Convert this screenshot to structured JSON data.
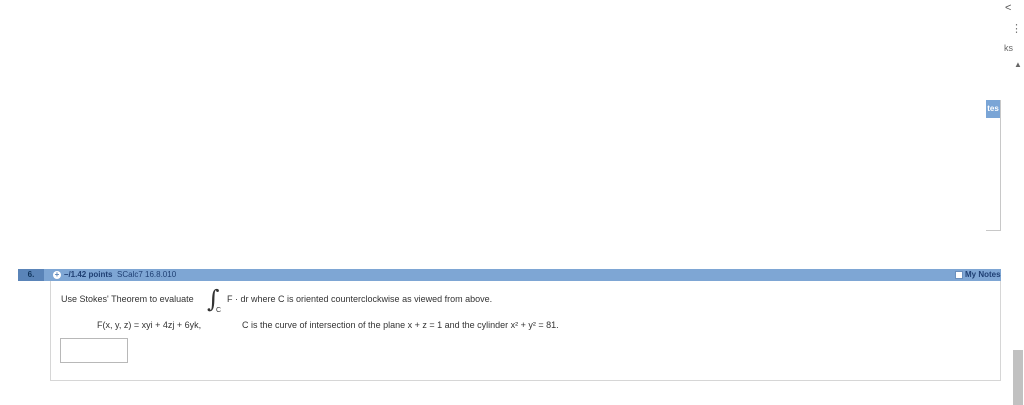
{
  "chrome": {
    "back_glyph": "<",
    "more_glyph": "⋮",
    "ks_fragment": "ks",
    "up_arrow": "▲"
  },
  "prev_notes_fragment": "tes",
  "question": {
    "number": "6.",
    "points": "–/1.42 points",
    "code": "SCalc7 16.8.010",
    "my_notes_label": "My Notes",
    "prompt_lead": "Use Stokes' Theorem to evaluate",
    "integral_symbol": "∫",
    "integral_subscript": "C",
    "prompt_tail": "F · dr  where C is oriented counterclockwise as viewed from above.",
    "field": "F(x, y, z) = xyi + 4zj + 6yk,",
    "curve": "C is the curve of intersection of the plane  x + z = 1  and the cylinder  x² + y² = 81.",
    "answer_value": ""
  },
  "colors": {
    "header_bar": "#7ea6d4",
    "number_cell": "#5a84b8",
    "header_text": "#1f3f73"
  }
}
